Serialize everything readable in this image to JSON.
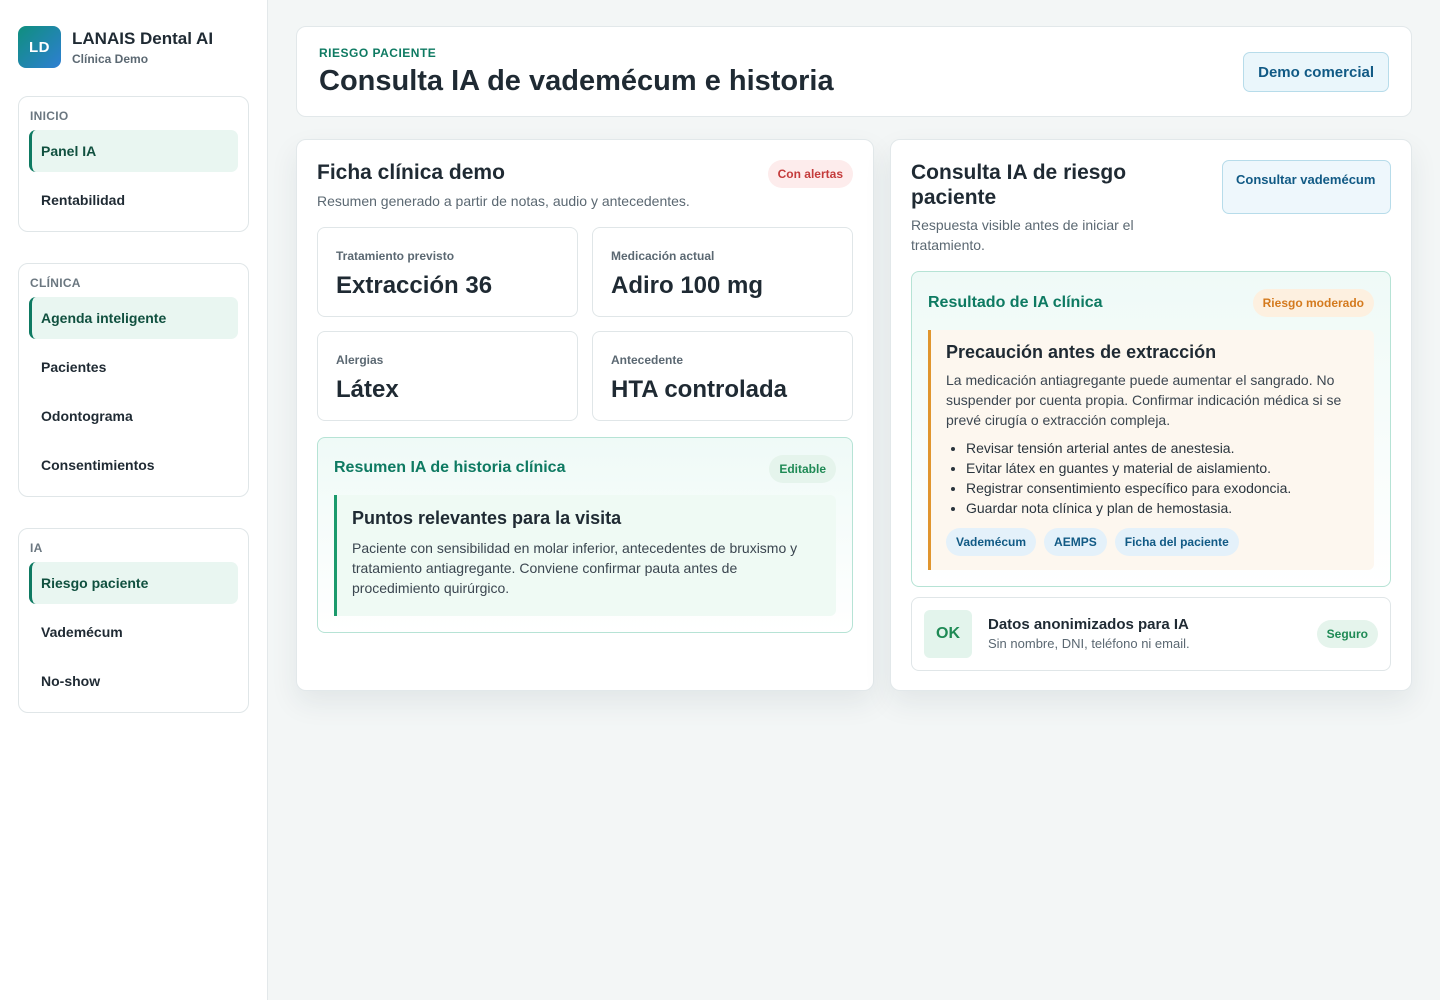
{
  "brand": {
    "logo": "LD",
    "name": "LANAIS Dental AI",
    "subtitle": "Clínica Demo"
  },
  "sidebar": {
    "groups": [
      {
        "title": "INICIO",
        "items": [
          {
            "label": "Panel IA",
            "active": true
          },
          {
            "label": "Rentabilidad"
          }
        ]
      },
      {
        "title": "CLÍNICA",
        "items": [
          {
            "label": "Agenda inteligente",
            "active": true
          },
          {
            "label": "Pacientes"
          },
          {
            "label": "Odontograma"
          },
          {
            "label": "Consentimientos"
          }
        ]
      },
      {
        "title": "IA",
        "items": [
          {
            "label": "Riesgo paciente",
            "active": true
          },
          {
            "label": "Vademécum"
          },
          {
            "label": "No-show"
          }
        ]
      }
    ]
  },
  "header": {
    "eyebrow": "RIESGO PACIENTE",
    "title": "Consulta IA de vademécum e historia",
    "demo_button": "Demo comercial"
  },
  "ficha": {
    "title": "Ficha clínica demo",
    "subtitle": "Resumen generado a partir de notas, audio y antecedentes.",
    "badge": "Con alertas",
    "stats": [
      {
        "label": "Tratamiento previsto",
        "value": "Extracción 36"
      },
      {
        "label": "Medicación actual",
        "value": "Adiro 100 mg"
      },
      {
        "label": "Alergias",
        "value": "Látex"
      },
      {
        "label": "Antecedente",
        "value": "HTA controlada"
      }
    ],
    "summary": {
      "title": "Resumen IA de historia clínica",
      "badge": "Editable",
      "note_title": "Puntos relevantes para la visita",
      "note_text": "Paciente con sensibilidad en molar inferior, antecedentes de bruxismo y tratamiento antiagregante. Conviene confirmar pauta antes de procedimiento quirúrgico."
    }
  },
  "consulta": {
    "title": "Consulta IA de riesgo paciente",
    "subtitle": "Respuesta visible antes de iniciar el tratamiento.",
    "button": "Consultar vademécum",
    "result": {
      "title": "Resultado de IA clínica",
      "badge": "Riesgo moderado",
      "warning_title": "Precaución antes de extracción",
      "warning_text": "La medicación antiagregante puede aumentar el sangrado. No suspender por cuenta propia. Confirmar indicación médica si se prevé cirugía o extracción compleja.",
      "bullets": [
        "Revisar tensión arterial antes de anestesia.",
        "Evitar látex en guantes y material de aislamiento.",
        "Registrar consentimiento específico para exodoncia.",
        "Guardar nota clínica y plan de hemostasia."
      ],
      "sources": [
        "Vademécum",
        "AEMPS",
        "Ficha del paciente"
      ]
    },
    "privacy": {
      "icon_text": "OK",
      "title": "Datos anonimizados para IA",
      "subtitle": "Sin nombre, DNI, teléfono ni email.",
      "badge": "Seguro"
    }
  },
  "colors": {
    "accent": "#0e7a62",
    "link": "#115a85",
    "alert": "#c43b3b",
    "warning": "#e0952e",
    "success": "#1f8a55"
  }
}
